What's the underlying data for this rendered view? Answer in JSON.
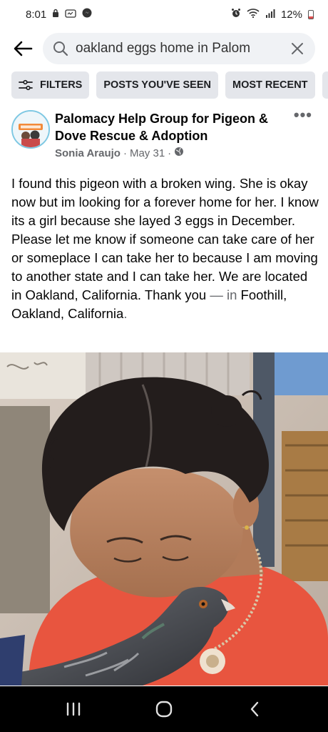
{
  "status_bar": {
    "time": "8:01",
    "battery": "12%",
    "icons": [
      "lock-icon",
      "notification-icon",
      "messenger-icon",
      "alarm-icon",
      "wifi-icon",
      "signal-icon",
      "battery-icon"
    ]
  },
  "search": {
    "query": "oakland eggs home in Palom",
    "icons": [
      "back-arrow-icon",
      "search-icon",
      "close-icon"
    ]
  },
  "filters": {
    "chips": [
      {
        "label": "FILTERS",
        "icon": "filter-sliders-icon"
      },
      {
        "label": "POSTS YOU'VE SEEN"
      },
      {
        "label": "MOST RECENT"
      },
      {
        "label": "P"
      }
    ]
  },
  "post": {
    "group_name": "Palomacy Help Group for Pigeon & Dove Rescue & Adoption",
    "author": "Sonia Araujo",
    "separator": "·",
    "date": "May 31",
    "privacy_icon": "globe-icon",
    "more_icon": "more-options-icon",
    "more_glyph": "•••",
    "body": "I found this pigeon with a broken wing. She is okay now but im looking for a forever home for her. I know its a girl because she layed 3 eggs in December. Please let me know if someone can take care of her or someplace I can take her to because I am moving to another state and I can take her. We are located in Oakland, California. Thank you",
    "dash": " — ",
    "in_word": "in",
    "location": "Foothill, Oakland, California",
    "period": "."
  },
  "photo": {
    "subject": "woman-with-pigeon-photo"
  },
  "navigation": {
    "icons": [
      "recent-apps-icon",
      "home-icon",
      "back-icon"
    ]
  },
  "colors": {
    "chip_bg": "#e4e6eb",
    "search_bg": "#f0f2f5",
    "secondary_text": "#65676b",
    "nav_bar": "#000000",
    "shirt": "#e8553f"
  }
}
